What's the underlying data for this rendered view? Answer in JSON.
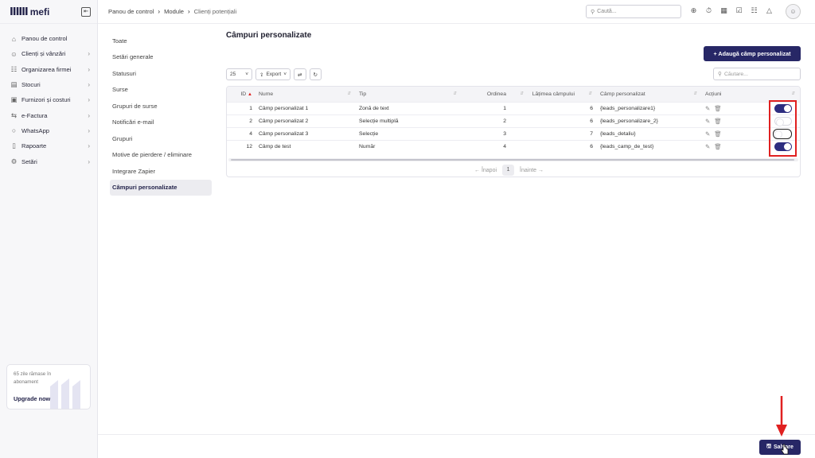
{
  "app": {
    "logo_mark": "ⅡⅡⅡ",
    "name": "mefi"
  },
  "sidebar": {
    "items": [
      {
        "icon": "home-icon",
        "glyph": "⌂",
        "label": "Panou de control",
        "chevron": ""
      },
      {
        "icon": "users-icon",
        "glyph": "☺",
        "label": "Clienți și vânzări",
        "chevron": "›"
      },
      {
        "icon": "building-icon",
        "glyph": "☷",
        "label": "Organizarea firmei",
        "chevron": "›"
      },
      {
        "icon": "box-icon",
        "glyph": "▤",
        "label": "Stocuri",
        "chevron": "›"
      },
      {
        "icon": "truck-icon",
        "glyph": "▣",
        "label": "Furnizori și costuri",
        "chevron": "›"
      },
      {
        "icon": "efactura-icon",
        "glyph": "⇆",
        "label": "e-Factura",
        "chevron": "›"
      },
      {
        "icon": "whatsapp-icon",
        "glyph": "○",
        "label": "WhatsApp",
        "chevron": "›"
      },
      {
        "icon": "clipboard-icon",
        "glyph": "▯",
        "label": "Rapoarte",
        "chevron": "›"
      },
      {
        "icon": "gear-icon",
        "glyph": "⚙",
        "label": "Setări",
        "chevron": "›"
      }
    ],
    "upgrade": {
      "text": "65 zile rămase în abonament",
      "link": "Upgrade now →"
    }
  },
  "topbar": {
    "breadcrumb": [
      "Panou de control",
      "Module",
      "Clienți potențiali"
    ],
    "search_placeholder": "Caută...",
    "icons": [
      "⊕",
      "⏱",
      "▦",
      "☑",
      "☷",
      "△"
    ]
  },
  "subnav": {
    "items": [
      "Toate",
      "Setări generale",
      "Statusuri",
      "Surse",
      "Grupuri de surse",
      "Notificări e-mail",
      "Grupuri",
      "Motive de pierdere / eliminare",
      "Integrare Zapier",
      "Câmpuri personalizate"
    ],
    "active_index": 9
  },
  "page": {
    "title": "Câmpuri personalizate",
    "add_button": "+ Adaugă câmp personalizat",
    "page_size": "25",
    "export_label": "Export",
    "search_placeholder": "Căutare...",
    "columns": [
      "ID",
      "Nume",
      "Tip",
      "Ordinea",
      "Lățimea câmpului",
      "Câmp personalizat",
      "Acțiuni",
      ""
    ],
    "rows": [
      {
        "id": "1",
        "name": "Câmp personalizat 1",
        "type": "Zonă de text",
        "order": "1",
        "width": "6",
        "field": "{leads_personalizare1}",
        "active": true
      },
      {
        "id": "2",
        "name": "Câmp personalizat 2",
        "type": "Selecție multiplă",
        "order": "2",
        "width": "6",
        "field": "{leads_personalizare_2}",
        "active": false
      },
      {
        "id": "4",
        "name": "Câmp personalizat 3",
        "type": "Selecție",
        "order": "3",
        "width": "7",
        "field": "{leads_detaliu}",
        "active": false
      },
      {
        "id": "12",
        "name": "Câmp de test",
        "type": "Număr",
        "order": "4",
        "width": "6",
        "field": "{leads_camp_de_test}",
        "active": true
      }
    ],
    "pager": {
      "prev": "← Înapoi",
      "current": "1",
      "next": "Înainte →"
    }
  },
  "footer": {
    "save_label": "Salvare"
  },
  "colors": {
    "accent": "#272766",
    "highlight": "#e02020"
  }
}
